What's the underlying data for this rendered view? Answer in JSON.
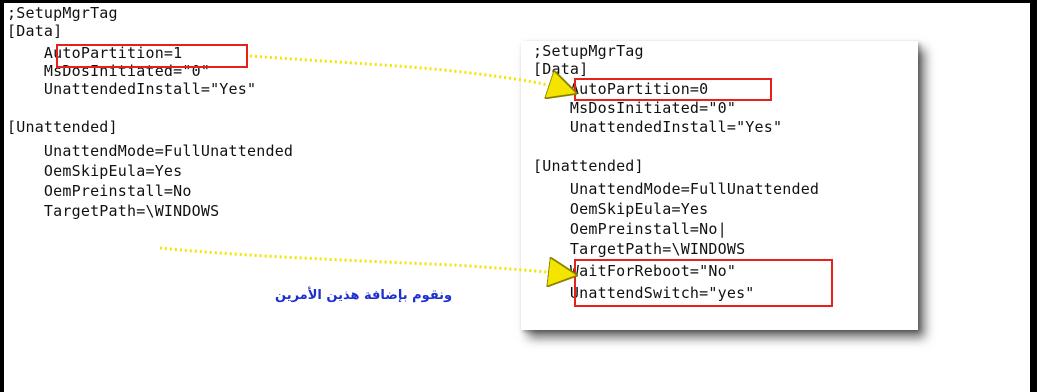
{
  "left_file": {
    "lines": [
      ";SetupMgrTag",
      "[Data]",
      "    AutoPartition=1",
      "    MsDosInitiated=\"0\"",
      "    UnattendedInstall=\"Yes\"",
      "",
      "[Unattended]",
      "    UnattendMode=FullUnattended",
      "    OemSkipEula=Yes",
      "    OemPreinstall=No",
      "    TargetPath=\\WINDOWS"
    ]
  },
  "right_file": {
    "lines": [
      ";SetupMgrTag",
      "[Data]",
      "    AutoPartition=0",
      "    MsDosInitiated=\"0\"",
      "    UnattendedInstall=\"Yes\"",
      "",
      "[Unattended]",
      "    UnattendMode=FullUnattended",
      "    OemSkipEula=Yes",
      "    OemPreinstall=No|",
      "    TargetPath=\\WINDOWS",
      "    WaitForReboot=\"No\"",
      "    UnattendSwitch=\"yes\""
    ]
  },
  "annotation": {
    "text": "ونقوم بإضافة هذين الأمرين"
  },
  "colors": {
    "highlight_box": "#e8201a",
    "arrow": "#f5e400",
    "annotation_text": "#1e2fd0"
  }
}
